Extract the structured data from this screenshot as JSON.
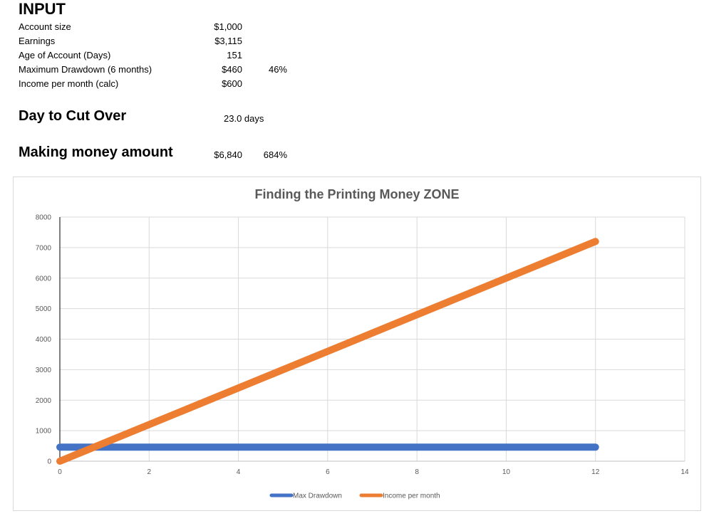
{
  "input": {
    "heading": "INPUT",
    "rows": [
      {
        "label": "Account size",
        "value": "$1,000",
        "pct": ""
      },
      {
        "label": "Earnings",
        "value": "$3,115",
        "pct": ""
      },
      {
        "label": "Age of Account (Days)",
        "value": "151",
        "pct": ""
      },
      {
        "label": "Maximum Drawdown (6 months)",
        "value": "$460",
        "pct": "46%"
      },
      {
        "label": "Income per month (calc)",
        "value": "$600",
        "pct": ""
      }
    ]
  },
  "cutover": {
    "label": "Day to Cut Over",
    "value": "23.0 days"
  },
  "making_money": {
    "label": "Making money amount",
    "value": "$6,840",
    "pct": "684%"
  },
  "chart_data": {
    "type": "line",
    "title": "Finding the Printing Money ZONE",
    "xlabel": "",
    "ylabel": "",
    "xlim": [
      0,
      14
    ],
    "ylim": [
      0,
      8000
    ],
    "x_ticks": [
      0,
      2,
      4,
      6,
      8,
      10,
      12,
      14
    ],
    "y_ticks": [
      0,
      1000,
      2000,
      3000,
      4000,
      5000,
      6000,
      7000,
      8000
    ],
    "grid": true,
    "legend_position": "bottom",
    "series": [
      {
        "name": "Max Drawdown",
        "color": "#4472c4",
        "x": [
          0,
          12
        ],
        "y": [
          460,
          460
        ]
      },
      {
        "name": "Income per month",
        "color": "#ed7d31",
        "x": [
          0,
          12
        ],
        "y": [
          0,
          7200
        ]
      }
    ]
  }
}
